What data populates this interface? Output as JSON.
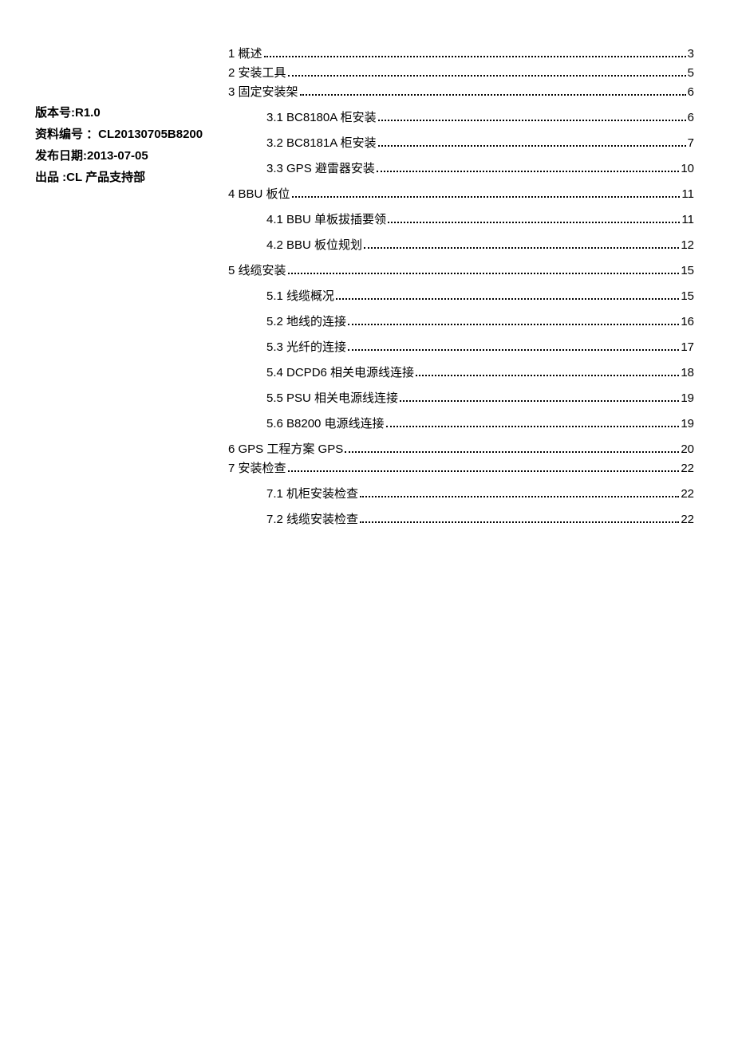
{
  "sidebar": {
    "version_label": "版本号:",
    "version_value": "R1.0",
    "docnum_label": "资料编号 ：",
    "docnum_value": "CL20130705B8200",
    "pubdate_label": "发布日期:",
    "pubdate_value": "2013-07-05",
    "publisher_label": "出品 :",
    "publisher_value": "CL 产品支持部"
  },
  "toc": [
    {
      "level": 1,
      "num": "1",
      "title": "概述",
      "page": "3"
    },
    {
      "level": 1,
      "num": "2",
      "title": "安装工具",
      "page": "5"
    },
    {
      "level": 1,
      "num": "3",
      "title": "固定安装架",
      "page": "6"
    },
    {
      "level": 2,
      "num": "3.1",
      "title": "BC8180A 柜安装",
      "page": "6"
    },
    {
      "level": 2,
      "num": "3.2",
      "title": "BC8181A 柜安装",
      "page": "7"
    },
    {
      "level": 2,
      "num": "3.3",
      "title": "GPS 避雷器安装",
      "page": "10"
    },
    {
      "level": 1,
      "num": "4",
      "title": "BBU 板位",
      "page": "11"
    },
    {
      "level": 2,
      "num": "4.1",
      "title": "BBU 单板拔插要领",
      "page": "11"
    },
    {
      "level": 2,
      "num": "4.2",
      "title": "BBU 板位规划",
      "page": "12"
    },
    {
      "level": 1,
      "num": "5",
      "title": "线缆安装",
      "page": "15"
    },
    {
      "level": 2,
      "num": "5.1",
      "title": "线缆概况",
      "page": "15"
    },
    {
      "level": 2,
      "num": "5.2",
      "title": "地线的连接",
      "page": "16"
    },
    {
      "level": 2,
      "num": "5.3",
      "title": "光纤的连接",
      "page": "17"
    },
    {
      "level": 2,
      "num": "5.4",
      "title": "DCPD6 相关电源线连接",
      "page": "18"
    },
    {
      "level": 2,
      "num": "5.5",
      "title": "PSU 相关电源线连接",
      "page": "19"
    },
    {
      "level": 2,
      "num": "5.6",
      "title": "B8200 电源线连接",
      "page": "19"
    },
    {
      "level": 1,
      "num": "6",
      "title": "GPS 工程方案    GPS",
      "page": "20"
    },
    {
      "level": 1,
      "num": "7",
      "title": "安装检查",
      "page": "22"
    },
    {
      "level": 2,
      "num": "7.1",
      "title": "机柜安装检查",
      "page": "22"
    },
    {
      "level": 2,
      "num": "7.2",
      "title": "线缆安装检查",
      "page": "22"
    }
  ]
}
